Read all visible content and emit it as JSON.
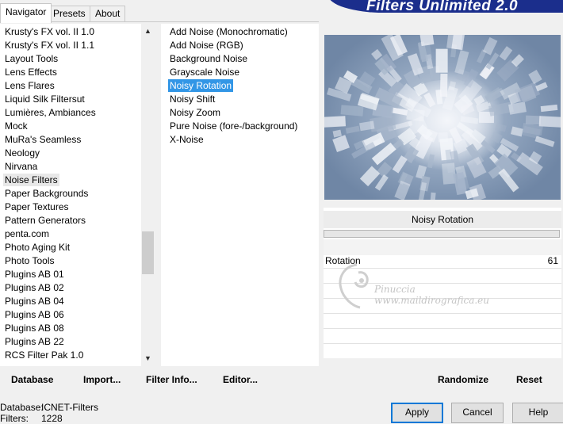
{
  "tabs": [
    {
      "label": "Navigator",
      "active": true
    },
    {
      "label": "Presets",
      "active": false
    },
    {
      "label": "About",
      "active": false
    }
  ],
  "banner": {
    "title": "Filters Unlimited 2.0"
  },
  "categories": {
    "selected": "Noise Filters",
    "items": [
      "Krusty's FX vol. II 1.0",
      "Krusty's FX vol. II 1.1",
      "Layout Tools",
      "Lens Effects",
      "Lens Flares",
      "Liquid Silk Filtersut",
      "Lumières, Ambiances",
      "Mock",
      "MuRa's Seamless",
      "Neology",
      "Nirvana",
      "Noise Filters",
      "Paper Backgrounds",
      "Paper Textures",
      "Pattern Generators",
      "penta.com",
      "Photo Aging Kit",
      "Photo Tools",
      "Plugins AB 01",
      "Plugins AB 02",
      "Plugins AB 04",
      "Plugins AB 06",
      "Plugins AB 08",
      "Plugins AB 22",
      "RCS Filter Pak 1.0"
    ]
  },
  "filters": {
    "selected": "Noisy Rotation",
    "items": [
      "Add Noise (Monochromatic)",
      "Add Noise (RGB)",
      "Background Noise",
      "Grayscale Noise",
      "Noisy Rotation",
      "Noisy Shift",
      "Noisy Zoom",
      "Pure Noise (fore-/background)",
      "X-Noise"
    ]
  },
  "preview": {
    "colors": {
      "light": "#f4f6fa",
      "mid": "#a9b8cc",
      "dark": "#6f86a5"
    }
  },
  "parameters": {
    "filter_title": "Noisy Rotation",
    "rows": [
      {
        "label": "Rotation",
        "value": "61"
      }
    ]
  },
  "watermark": {
    "name": "Pinuccia",
    "url": "www.maildirografica.eu"
  },
  "toolbar": {
    "database": "Database",
    "import": "Import...",
    "filter_info": "Filter Info...",
    "editor": "Editor...",
    "randomize": "Randomize",
    "reset": "Reset"
  },
  "info": {
    "database_label": "Database:",
    "database_value": "ICNET-Filters",
    "filters_label": "Filters:",
    "filters_value": "1228"
  },
  "buttons": {
    "apply": "Apply",
    "cancel": "Cancel",
    "help": "Help"
  },
  "colors": {
    "selection": "#3296e6",
    "banner": "#1b2e8c",
    "accent_border": "#0078d7"
  }
}
